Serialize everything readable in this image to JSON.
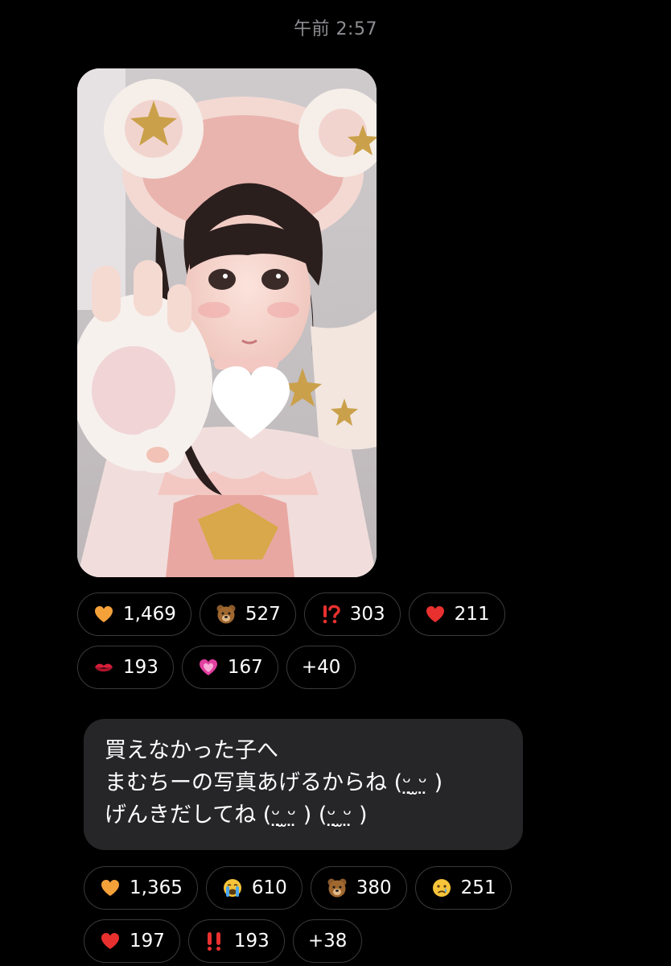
{
  "timestamp": "午前 2:57",
  "photo": {
    "label": "photo-message"
  },
  "reactions_photo": [
    {
      "icon": "orange-heart-icon",
      "count": "1,469"
    },
    {
      "icon": "bear-face-icon",
      "count": "527"
    },
    {
      "icon": "exclamation-question-icon",
      "count": "303"
    },
    {
      "icon": "red-heart-icon",
      "count": "211"
    },
    {
      "icon": "kiss-mark-icon",
      "count": "193"
    },
    {
      "icon": "growing-heart-icon",
      "count": "167"
    },
    {
      "icon": "",
      "count": "+40"
    }
  ],
  "message": {
    "lines": [
      "買えなかった子へ",
      "まむちーの写真あげるからね (ᵕ̤ ̫ᵕ̤ )",
      "げんきだしてね (ᵕ̤ ̫ᵕ̤ ) (ᵕ̤ ̫ᵕ̤ )"
    ]
  },
  "reactions_message": [
    {
      "icon": "orange-heart-icon",
      "count": "1,365"
    },
    {
      "icon": "loudly-crying-face-icon",
      "count": "610"
    },
    {
      "icon": "bear-face-icon",
      "count": "380"
    },
    {
      "icon": "crying-face-icon",
      "count": "251"
    },
    {
      "icon": "red-heart-icon",
      "count": "197"
    },
    {
      "icon": "double-exclamation-icon",
      "count": "193"
    },
    {
      "icon": "",
      "count": "+38"
    }
  ]
}
